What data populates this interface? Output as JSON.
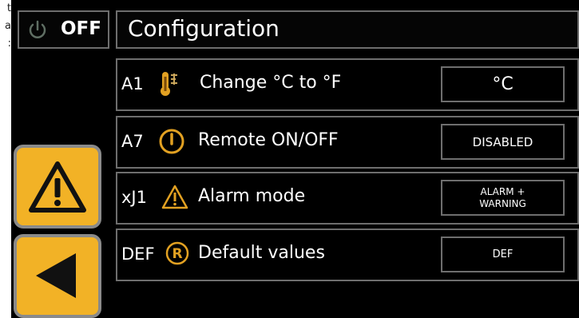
{
  "side_text": [
    "t",
    "a",
    ":"
  ],
  "header": {
    "power_label": "OFF",
    "title": "Configuration"
  },
  "nav": {
    "alarm_icon": "warning-triangle-icon",
    "back_icon": "back-arrow-icon"
  },
  "rows": [
    {
      "code": "A1",
      "icon": "thermometer-icon",
      "label": "Change °C to °F",
      "value": "°C"
    },
    {
      "code": "A7",
      "icon": "power-circle-icon",
      "label": "Remote ON/OFF",
      "value": "DISABLED"
    },
    {
      "code": "xJ1",
      "icon": "warning-icon",
      "label": "Alarm mode",
      "value": "ALARM +\nWARNING"
    },
    {
      "code": "DEF",
      "icon": "reset-r-icon",
      "label": "Default values",
      "value": "DEF"
    }
  ],
  "colors": {
    "accent": "#f2b226",
    "border": "#6e6e6e",
    "background": "#000000",
    "text": "#ffffff"
  }
}
